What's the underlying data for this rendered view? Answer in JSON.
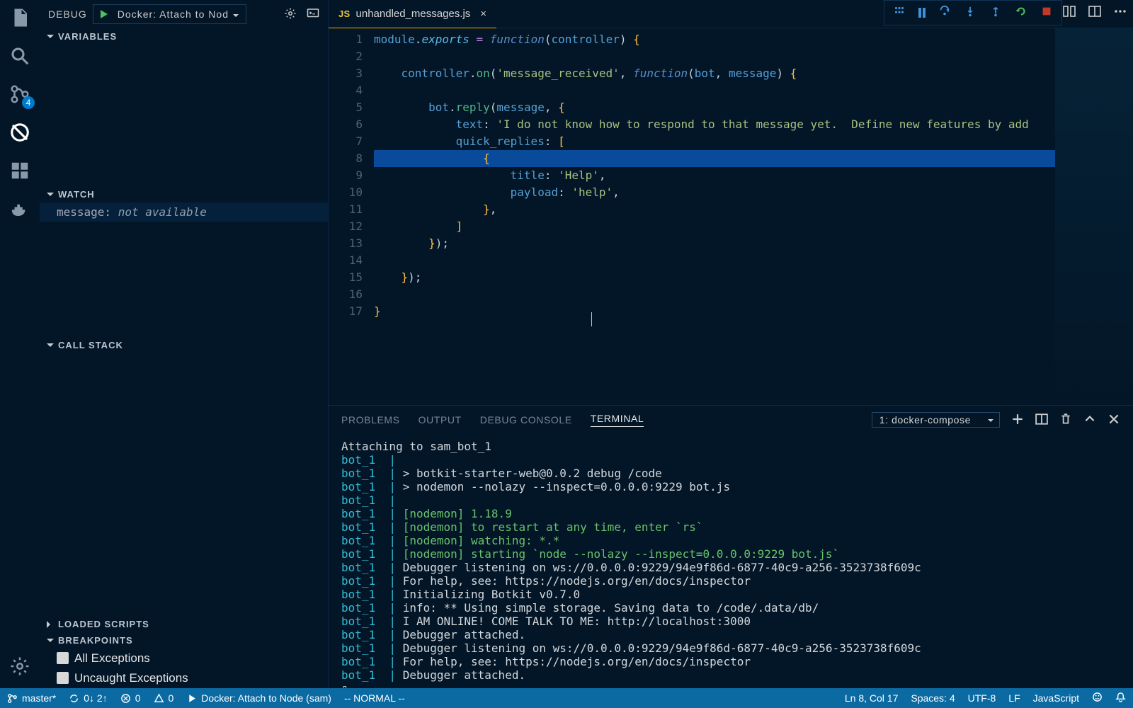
{
  "activity_bar": {
    "scm_badge": "4"
  },
  "side_panel": {
    "title": "DEBUG",
    "config_selected": "Docker: Attach to Nod",
    "sections": {
      "variables": "VARIABLES",
      "watch": "WATCH",
      "call_stack": "CALL STACK",
      "loaded_scripts": "LOADED SCRIPTS",
      "breakpoints": "BREAKPOINTS"
    },
    "watch_rows": [
      {
        "name": "message:",
        "value": "not available"
      }
    ],
    "breakpoints": [
      "All Exceptions",
      "Uncaught Exceptions"
    ]
  },
  "tabs": [
    {
      "icon": "JS",
      "label": "unhandled_messages.js",
      "active": true
    }
  ],
  "code_lines": [
    {
      "n": 1,
      "html": "<span class='tk-v'>module</span>.<span class='tk-m'>exports</span> <span class='tk-p'>=</span> <span class='tk-k'>function</span>(<span class='tk-v'>controller</span>) <span class='tk-b'>{</span>"
    },
    {
      "n": 2,
      "html": ""
    },
    {
      "n": 3,
      "html": "    <span class='tk-v'>controller</span>.<span class='tk-f'>on</span>(<span class='tk-s'>'message_received'</span>, <span class='tk-k'>function</span>(<span class='tk-v'>bot</span>, <span class='tk-v'>message</span>) <span class='tk-b'>{</span>"
    },
    {
      "n": 4,
      "html": ""
    },
    {
      "n": 5,
      "html": "        <span class='tk-v'>bot</span>.<span class='tk-f'>reply</span>(<span class='tk-v'>message</span>, <span class='tk-b'>{</span>"
    },
    {
      "n": 6,
      "html": "            <span class='tk-v'>text</span>: <span class='tk-s'>'I do not know how to respond to that message yet.  Define new features by add</span>"
    },
    {
      "n": 7,
      "html": "            <span class='tk-v'>quick_replies</span>: <span class='tk-b'>[</span>"
    },
    {
      "n": 8,
      "html": "                <span class='tk-b'>{</span>",
      "hl": true
    },
    {
      "n": 9,
      "html": "                    <span class='tk-v'>title</span>: <span class='tk-s'>'Help'</span>,"
    },
    {
      "n": 10,
      "html": "                    <span class='tk-v'>payload</span>: <span class='tk-s'>'help'</span>,"
    },
    {
      "n": 11,
      "html": "                <span class='tk-b'>}</span>,"
    },
    {
      "n": 12,
      "html": "            <span class='tk-b'>]</span>"
    },
    {
      "n": 13,
      "html": "        <span class='tk-b'>}</span>);"
    },
    {
      "n": 14,
      "html": ""
    },
    {
      "n": 15,
      "html": "    <span class='tk-b'>}</span>);"
    },
    {
      "n": 16,
      "html": ""
    },
    {
      "n": 17,
      "html": "<span class='tk-b'>}</span>"
    }
  ],
  "panel": {
    "tabs": {
      "problems": "PROBLEMS",
      "output": "OUTPUT",
      "debug": "DEBUG CONSOLE",
      "terminal": "TERMINAL"
    },
    "active_tab": "terminal",
    "terminal_select": "1: docker-compose"
  },
  "terminal_lines": [
    {
      "src": "",
      "text": "Attaching to sam_bot_1"
    },
    {
      "src": "bot_1  |",
      "text": " "
    },
    {
      "src": "bot_1  |",
      "text": " > botkit-starter-web@0.0.2 debug /code"
    },
    {
      "src": "bot_1  |",
      "text": " > nodemon --nolazy --inspect=0.0.0.0:9229 bot.js"
    },
    {
      "src": "bot_1  |",
      "text": " "
    },
    {
      "src": "bot_1  |",
      "green": " [nodemon] 1.18.9"
    },
    {
      "src": "bot_1  |",
      "green": " [nodemon] to restart at any time, enter `rs`"
    },
    {
      "src": "bot_1  |",
      "green": " [nodemon] watching: *.*"
    },
    {
      "src": "bot_1  |",
      "green": " [nodemon] starting `node --nolazy --inspect=0.0.0.0:9229 bot.js`"
    },
    {
      "src": "bot_1  |",
      "text": " Debugger listening on ws://0.0.0.0:9229/94e9f86d-6877-40c9-a256-3523738f609c"
    },
    {
      "src": "bot_1  |",
      "text": " For help, see: https://nodejs.org/en/docs/inspector"
    },
    {
      "src": "bot_1  |",
      "text": " Initializing Botkit v0.7.0"
    },
    {
      "src": "bot_1  |",
      "text": " info: ** Using simple storage. Saving data to /code/.data/db/"
    },
    {
      "src": "bot_1  |",
      "text": " I AM ONLINE! COME TALK TO ME: http://localhost:3000"
    },
    {
      "src": "bot_1  |",
      "text": " Debugger attached."
    },
    {
      "src": "bot_1  |",
      "text": " Debugger listening on ws://0.0.0.0:9229/94e9f86d-6877-40c9-a256-3523738f609c"
    },
    {
      "src": "bot_1  |",
      "text": " For help, see: https://nodejs.org/en/docs/inspector"
    },
    {
      "src": "bot_1  |",
      "text": " Debugger attached."
    },
    {
      "src": "",
      "text": "▯"
    }
  ],
  "status": {
    "branch": "master*",
    "sync": "0↓ 2↑",
    "errors": "0",
    "warnings": "0",
    "debug_target": "Docker: Attach to Node (sam)",
    "vim_mode": "-- NORMAL --",
    "cursor_pos": "Ln 8, Col 17",
    "spaces": "Spaces: 4",
    "encoding": "UTF-8",
    "eol": "LF",
    "language": "JavaScript"
  }
}
